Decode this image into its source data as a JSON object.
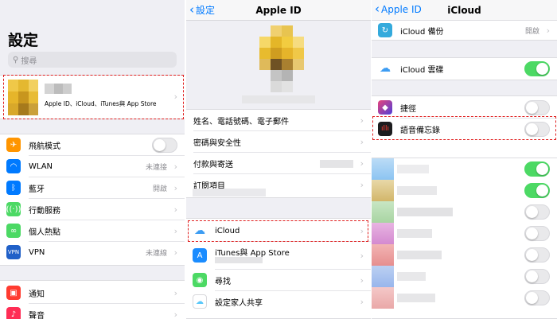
{
  "panel1": {
    "title": "設定",
    "search_placeholder": "搜尋",
    "profile_subtitle": "Apple ID、iCloud、iTunes與 App Store",
    "items": [
      {
        "label": "飛航模式",
        "icon": "airplane-icon",
        "color": "#ff9500"
      },
      {
        "label": "WLAN",
        "value": "未連接",
        "icon": "wifi-icon",
        "color": "#007aff"
      },
      {
        "label": "藍牙",
        "value": "開啟",
        "icon": "bluetooth-icon",
        "color": "#007aff"
      },
      {
        "label": "行動服務",
        "icon": "cellular-icon",
        "color": "#4cd964"
      },
      {
        "label": "個人熱點",
        "icon": "hotspot-icon",
        "color": "#4cd964"
      },
      {
        "label": "VPN",
        "value": "未連線",
        "icon": "vpn-icon",
        "color": "#2060c8"
      },
      {
        "label": "通知",
        "icon": "notifications-icon",
        "color": "#ff3b30"
      },
      {
        "label": "聲音",
        "icon": "sounds-icon",
        "color": "#ff2d55"
      }
    ]
  },
  "panel2": {
    "back_label": "設定",
    "title": "Apple ID",
    "items": [
      {
        "label": "姓名、電話號碼、電子郵件"
      },
      {
        "label": "密碼與安全性"
      },
      {
        "label": "付款與寄送"
      },
      {
        "label": "訂閱項目"
      },
      {
        "label": "iCloud",
        "icon": "icloud-icon",
        "color": "#3d9df3"
      },
      {
        "label": "iTunes與 App Store",
        "icon": "app-store-icon",
        "color": "#1a8cff"
      },
      {
        "label": "尋找",
        "icon": "find-my-icon",
        "color": "#4cd964"
      },
      {
        "label": "設定家人共享",
        "icon": "family-sharing-icon",
        "color": "#5ac8fa"
      }
    ]
  },
  "panel3": {
    "back_label": "Apple ID",
    "title": "iCloud",
    "items": [
      {
        "label": "iCloud 備份",
        "value": "開啟",
        "icon": "icloud-backup-icon",
        "color": "#34aadc"
      },
      {
        "label": "iCloud 雲碟",
        "icon": "icloud-drive-icon",
        "color": "#3d9df3"
      },
      {
        "label": "捷徑",
        "icon": "shortcuts-icon",
        "color": "#6b3fd1"
      },
      {
        "label": "語音備忘錄",
        "icon": "voice-memos-icon",
        "color": "#1c1c1e"
      }
    ],
    "toggles": [
      true,
      false,
      false,
      true,
      true,
      false,
      false,
      false,
      false,
      false,
      false
    ]
  }
}
